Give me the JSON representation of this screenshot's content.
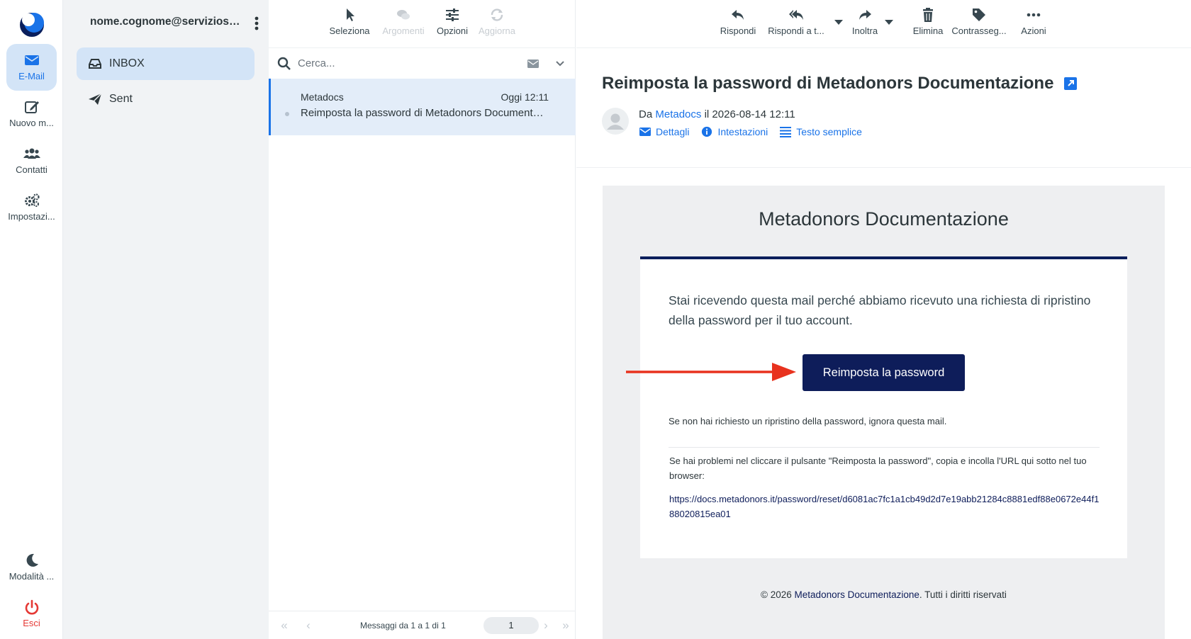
{
  "rail": {
    "items": [
      {
        "label": "E-Mail"
      },
      {
        "label": "Nuovo m..."
      },
      {
        "label": "Contatti"
      },
      {
        "label": "Impostazi..."
      },
      {
        "label": "Modalità ..."
      },
      {
        "label": "Esci"
      }
    ]
  },
  "folders": {
    "account": "nome.cognome@serviziosost...",
    "items": [
      {
        "label": "INBOX"
      },
      {
        "label": "Sent"
      }
    ]
  },
  "list_toolbar": {
    "select": "Seleziona",
    "threads": "Argomenti",
    "options": "Opzioni",
    "refresh": "Aggiorna"
  },
  "search": {
    "placeholder": "Cerca..."
  },
  "messages": [
    {
      "from": "Metadocs",
      "date": "Oggi 12:11",
      "subject": "Reimposta la password di Metadonors Documentazione"
    }
  ],
  "pager": {
    "info": "Messaggi da 1 a 1 di 1",
    "page": "1"
  },
  "view_toolbar": {
    "reply": "Rispondi",
    "reply_all": "Rispondi a t...",
    "forward": "Inoltra",
    "delete": "Elimina",
    "flag": "Contrasseg...",
    "actions": "Azioni"
  },
  "message": {
    "subject": "Reimposta la password di Metadonors Documentazione",
    "from_prefix": "Da",
    "from_name": "Metadocs",
    "date_text": "il 2026-08-14 12:11",
    "link_details": "Dettagli",
    "link_headers": "Intestazioni",
    "link_plain": "Testo semplice"
  },
  "mail": {
    "title": "Metadonors Documentazione",
    "intro": "Stai ricevendo questa mail perché abbiamo ricevuto una richiesta di ripristino della password per il tuo account.",
    "button": "Reimposta la password",
    "ignore": "Se non hai richiesto un ripristino della password, ignora questa mail.",
    "trouble": "Se hai problemi nel cliccare il pulsante \"Reimposta la password\", copia e incolla l'URL qui sotto nel tuo browser:",
    "url": "https://docs.metadonors.it/password/reset/d6081ac7fc1a1cb49d2d7e19abb21284c8881edf88e0672e44f188020815ea01",
    "footer_copy": "© 2026",
    "footer_brand": "Metadonors Documentazione",
    "footer_rights": ". Tutti i diritti riservati"
  },
  "colors": {
    "accent": "#1a73e8",
    "brand_navy": "#0e1d5a",
    "exit": "#e53935",
    "arrow": "#e8321e"
  }
}
